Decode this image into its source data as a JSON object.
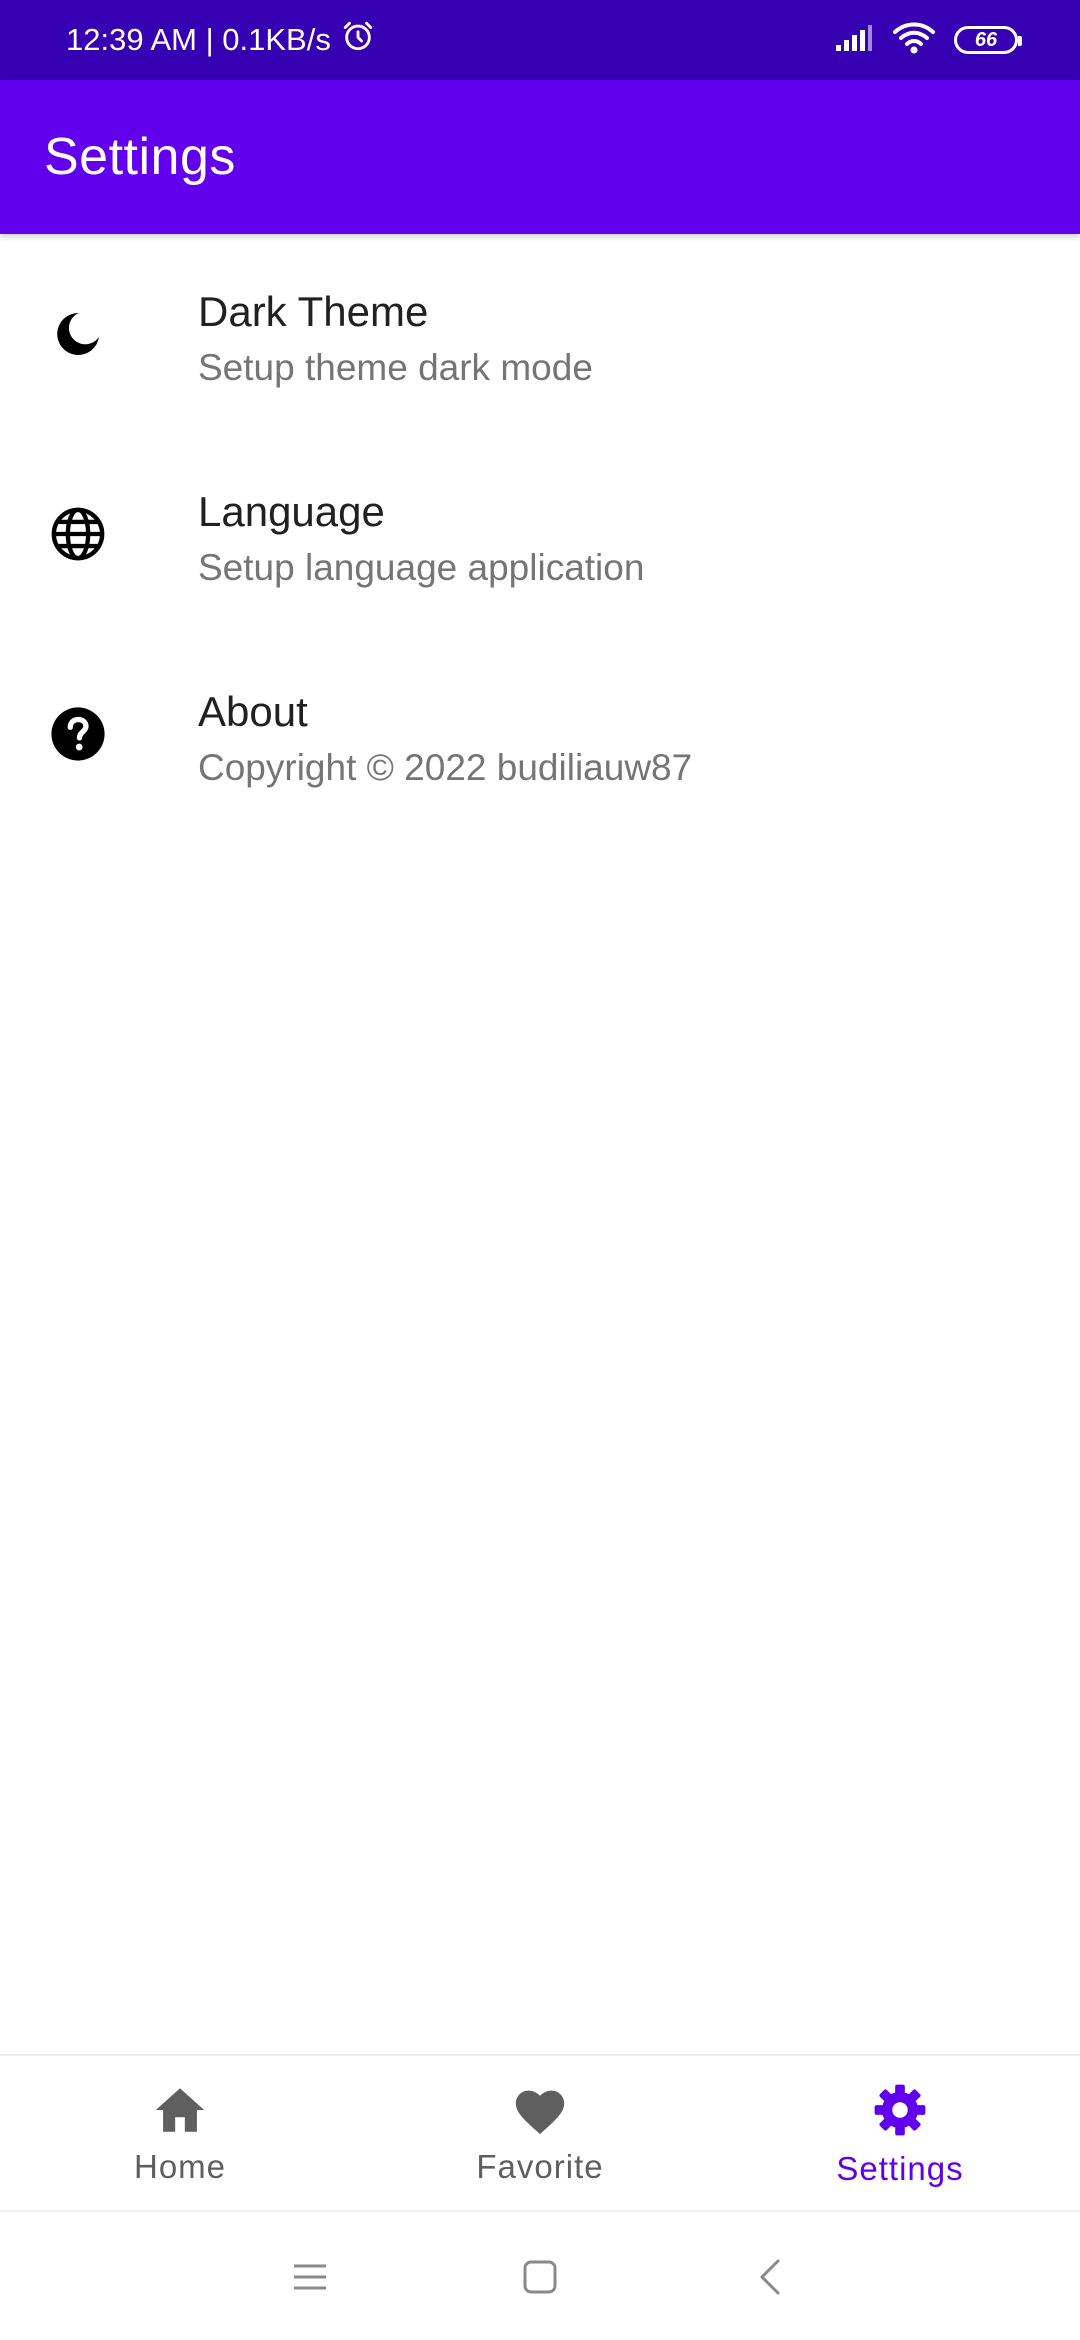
{
  "status_bar": {
    "time_speed": "12:39 AM | 0.1KB/s",
    "battery_level": "66",
    "icons": [
      "alarm-icon",
      "signal-icon",
      "wifi-icon",
      "battery-icon"
    ]
  },
  "app_bar": {
    "title": "Settings"
  },
  "settings": {
    "items": [
      {
        "title": "Dark Theme",
        "subtitle": "Setup theme dark mode",
        "icon": "moon-icon"
      },
      {
        "title": "Language",
        "subtitle": "Setup language application",
        "icon": "globe-icon"
      },
      {
        "title": "About",
        "subtitle": "Copyright © 2022 budiliauw87",
        "icon": "help-icon"
      }
    ]
  },
  "bottom_nav": {
    "items": [
      {
        "label": "Home",
        "icon": "home-icon",
        "active": false
      },
      {
        "label": "Favorite",
        "icon": "heart-icon",
        "active": false
      },
      {
        "label": "Settings",
        "icon": "gear-icon",
        "active": true
      }
    ]
  },
  "system_nav": {
    "buttons": [
      "menu-icon",
      "home-square-icon",
      "back-icon"
    ]
  },
  "colors": {
    "status_bar": "#3700b3",
    "primary": "#6200ee",
    "inactive_nav": "#5f5f5f",
    "title_text": "#212121",
    "subtitle_text": "#757575"
  }
}
